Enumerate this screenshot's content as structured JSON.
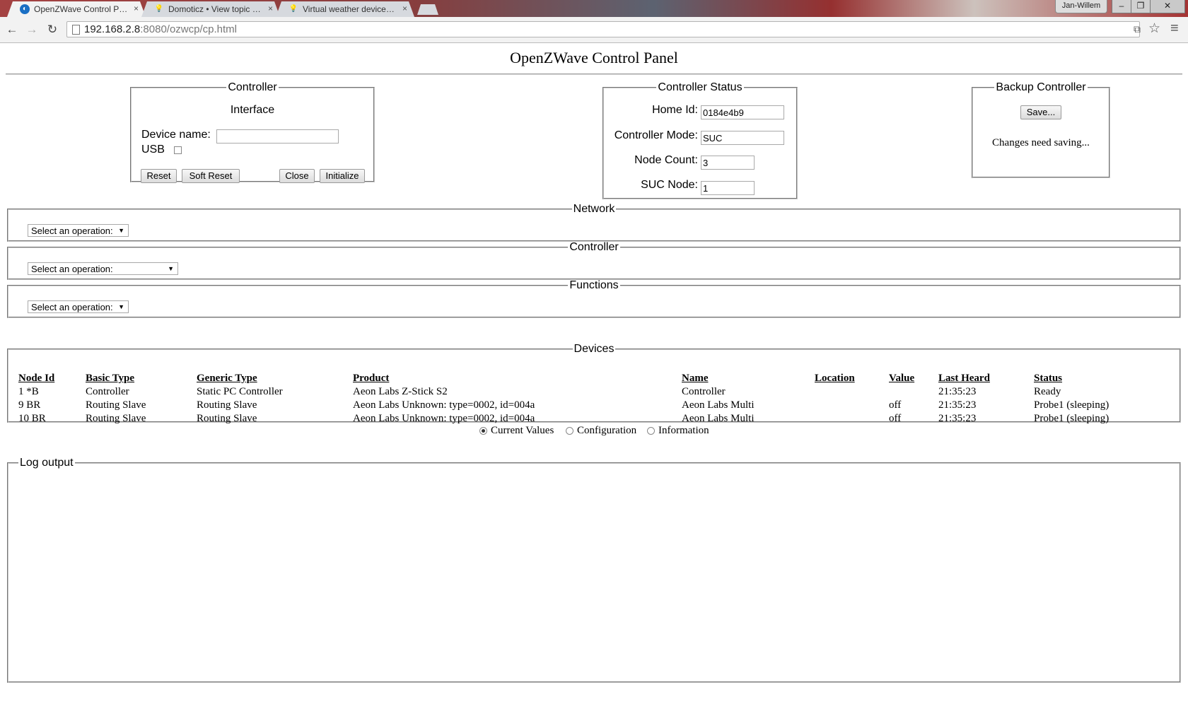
{
  "browser": {
    "tabs": [
      {
        "title": "OpenZWave Control Panel",
        "close": "×"
      },
      {
        "title": "Domoticz • View topic - N",
        "close": "×"
      },
      {
        "title": "Virtual weather devices - D",
        "close": "×"
      }
    ],
    "user": "Jan-Willem",
    "window_buttons": {
      "minimize": "–",
      "restore": "❐",
      "close": "✕"
    },
    "url_host": "192.168.2.8",
    "url_rest": ":8080/ozwcp/cp.html",
    "nav": {
      "back": "←",
      "forward": "→",
      "reload": "↻"
    },
    "toolbar_icons": {
      "translate": "⧉",
      "star": "☆",
      "menu": "≡"
    }
  },
  "page": {
    "title": "OpenZWave Control Panel",
    "controller": {
      "legend": "Controller",
      "subtitle": "Interface",
      "device_name_label": "Device name:",
      "device_name_value": "",
      "usb_label": "USB",
      "buttons": {
        "reset": "Reset",
        "soft_reset": "Soft Reset",
        "close": "Close",
        "initialize": "Initialize"
      }
    },
    "controller_status": {
      "legend": "Controller Status",
      "home_id_label": "Home Id:",
      "home_id_value": "0184e4b9",
      "mode_label": "Controller Mode:",
      "mode_value": "SUC",
      "node_count_label": "Node Count:",
      "node_count_value": "3",
      "suc_node_label": "SUC Node:",
      "suc_node_value": "1"
    },
    "backup": {
      "legend": "Backup Controller",
      "save_button": "Save...",
      "message": "Changes need saving..."
    },
    "network": {
      "legend": "Network",
      "select": "Select an operation:"
    },
    "controller_ops": {
      "legend": "Controller",
      "select": "Select an operation:"
    },
    "functions": {
      "legend": "Functions",
      "select": "Select an operation:"
    },
    "devices": {
      "legend": "Devices",
      "columns": [
        "Node Id",
        "Basic Type",
        "Generic Type",
        "Product",
        "Name",
        "Location",
        "Value",
        "Last Heard",
        "Status"
      ],
      "rows": [
        [
          "1 *B",
          "Controller",
          "Static PC Controller",
          "Aeon Labs Z-Stick S2",
          "Controller",
          "",
          "",
          "21:35:23",
          "Ready"
        ],
        [
          "9 BR",
          "Routing Slave",
          "Routing Slave",
          "Aeon Labs Unknown: type=0002, id=004a",
          "Aeon Labs Multi",
          "",
          "off",
          "21:35:23",
          "Probe1 (sleeping)"
        ],
        [
          "10 BR",
          "Routing Slave",
          "Routing Slave",
          "Aeon Labs Unknown: type=0002, id=004a",
          "Aeon Labs Multi",
          "",
          "off",
          "21:35:23",
          "Probe1 (sleeping)"
        ]
      ]
    },
    "view_options": {
      "current_values": "Current Values",
      "configuration": "Configuration",
      "information": "Information",
      "selected": "current_values"
    },
    "log": {
      "legend": "Log output"
    }
  }
}
